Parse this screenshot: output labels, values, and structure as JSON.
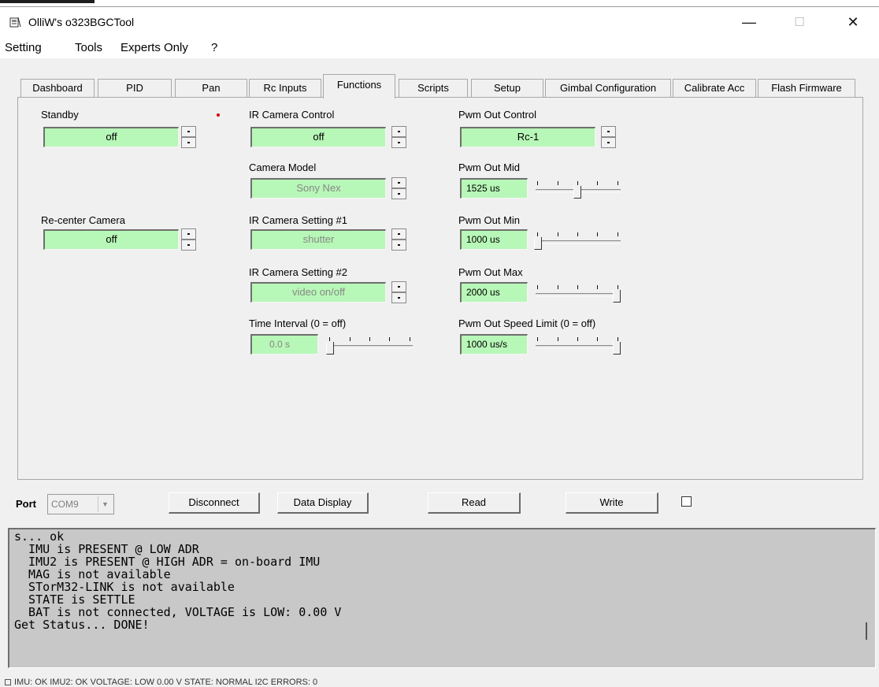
{
  "window": {
    "title": "OlliW's o323BGCTool",
    "minimize_glyph": "—",
    "maximize_glyph": "☐",
    "close_glyph": "✕"
  },
  "menu": [
    "Setting",
    "Tools",
    "Experts Only",
    "?"
  ],
  "tabs": [
    {
      "label": "Dashboard"
    },
    {
      "label": "PID"
    },
    {
      "label": "Pan"
    },
    {
      "label": "Rc Inputs"
    },
    {
      "label": "Functions",
      "active": true
    },
    {
      "label": "Scripts"
    },
    {
      "label": "Setup"
    },
    {
      "label": "Gimbal Configuration"
    },
    {
      "label": "Calibrate Acc"
    },
    {
      "label": "Flash Firmware"
    }
  ],
  "functions": {
    "standby": {
      "label": "Standby",
      "value": "off"
    },
    "recenter": {
      "label": "Re-center Camera",
      "value": "off"
    },
    "ir_control": {
      "label": "IR Camera Control",
      "value": "off"
    },
    "camera_model": {
      "label": "Camera Model",
      "value": "Sony Nex"
    },
    "ir_setting1": {
      "label": "IR Camera Setting #1",
      "value": "shutter"
    },
    "ir_setting2": {
      "label": "IR Camera Setting #2",
      "value": "video on/off"
    },
    "time_interval": {
      "label": "Time Interval (0 = off)",
      "value": "0.0 s"
    },
    "pwm_control": {
      "label": "Pwm Out Control",
      "value": "Rc-1"
    },
    "pwm_mid": {
      "label": "Pwm Out Mid",
      "value": "1525 us",
      "slider_fraction": 0.5
    },
    "pwm_min": {
      "label": "Pwm Out Min",
      "value": "1000 us",
      "slider_fraction": 0.0
    },
    "pwm_max": {
      "label": "Pwm Out Max",
      "value": "2000 us",
      "slider_fraction": 1.0
    },
    "pwm_speed": {
      "label": "Pwm Out Speed Limit (0 = off)",
      "value": "1000 us/s",
      "slider_fraction": 1.0
    }
  },
  "controls": {
    "port_label": "Port",
    "port_value": "COM9",
    "disconnect": "Disconnect",
    "data_display": "Data Display",
    "read": "Read",
    "write": "Write"
  },
  "console_lines": [
    "s... ok",
    "  IMU is PRESENT @ LOW ADR",
    "  IMU2 is PRESENT @ HIGH ADR = on-board IMU",
    "  MAG is not available",
    "  STorM32-LINK is not available",
    "  STATE is SETTLE",
    "  BAT is not connected, VOLTAGE is LOW: 0.00 V",
    "Get Status... DONE!"
  ],
  "statusbar": "IMU: OK   IMU2: OK   VOLTAGE: LOW 0.00 V   STATE: NORMAL   I2C ERRORS: 0",
  "colors": {
    "field_green": "#b7f7b7",
    "window_bg": "#f0f0f0",
    "console_bg": "#c8c8c8"
  }
}
